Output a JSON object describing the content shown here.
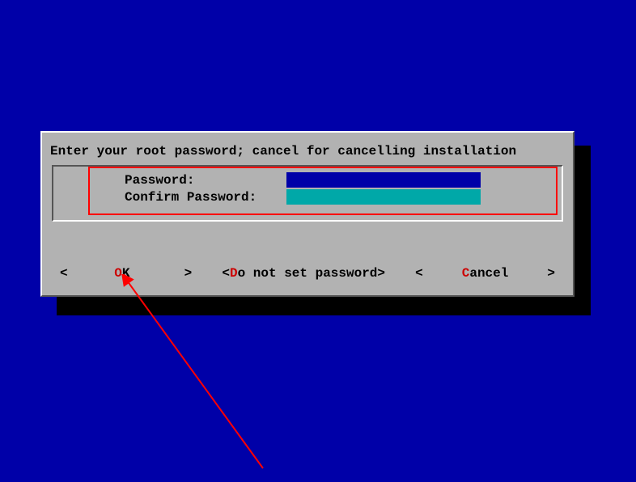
{
  "dialog": {
    "title": "Enter your root password; cancel for cancelling installation",
    "fields": {
      "password_label": "Password:",
      "confirm_label": "Confirm Password:",
      "password_value": "",
      "confirm_value": ""
    },
    "buttons": {
      "ok_bracket_left": "<",
      "ok_hotkey": "O",
      "ok_rest": "K",
      "ok_bracket_right": ">",
      "noset_bracket_left": "<",
      "noset_hotkey": "D",
      "noset_rest": "o not set password",
      "noset_bracket_right": ">",
      "cancel_bracket_left": "<",
      "cancel_hotkey": "C",
      "cancel_rest": "ancel",
      "cancel_bracket_right": ">"
    }
  }
}
